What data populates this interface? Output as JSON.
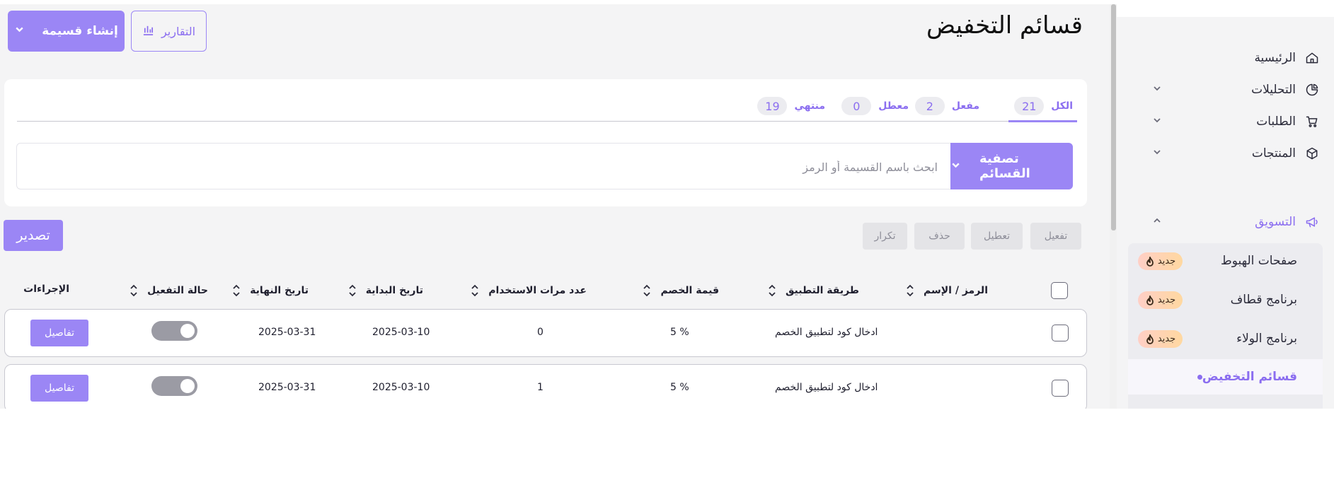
{
  "sidebar": {
    "items": [
      {
        "label": "الرئيسية",
        "icon": "home-icon"
      },
      {
        "label": "التحليلات",
        "icon": "pie-chart-icon"
      },
      {
        "label": "الطلبات",
        "icon": "cart-icon"
      },
      {
        "label": "المنتجات",
        "icon": "box-icon"
      },
      {
        "label": "التسويق",
        "icon": "megaphone-icon"
      }
    ],
    "submenu": [
      {
        "label": "صفحات الهبوط",
        "badge": "جديد"
      },
      {
        "label": "برنامج قطاف",
        "badge": "جديد"
      },
      {
        "label": "برنامج الولاء",
        "badge": "جديد"
      },
      {
        "label": "قسائم التخفيض"
      }
    ]
  },
  "header": {
    "title": "قسائم التخفيض",
    "create_label": "إنشاء قسيمة",
    "reports_label": "التقارير"
  },
  "tabs": [
    {
      "label": "الكل",
      "count": "21"
    },
    {
      "label": "مفعل",
      "count": "2"
    },
    {
      "label": "معطل",
      "count": "0"
    },
    {
      "label": "منتهي",
      "count": "19"
    }
  ],
  "search": {
    "filter_label": "تصفية القسائم",
    "placeholder": "ابحث باسم القسيمة أو الرمز"
  },
  "bulk_actions": {
    "activate": "تفعيل",
    "deactivate": "تعطيل",
    "delete": "حذف",
    "duplicate": "تكرار",
    "export": "تصدير"
  },
  "table": {
    "columns": {
      "code_name": "الرمز / الإسم",
      "apply_method": "طريقة التطبيق",
      "discount_value": "قيمة الخصم",
      "usage_count": "عدد مرات الاستخدام",
      "start_date": "تاريخ البداية",
      "end_date": "تاريخ النهاية",
      "status": "حالة التفعيل",
      "actions": "الإجراءات"
    },
    "rows": [
      {
        "apply_method": "ادخال كود لتطبيق الخصم",
        "discount_value": "5 %",
        "usage_count": "0",
        "start_date": "2025-03-10",
        "end_date": "2025-03-31",
        "details_label": "تفاصيل"
      },
      {
        "apply_method": "ادخال كود لتطبيق الخصم",
        "discount_value": "5 %",
        "usage_count": "1",
        "start_date": "2025-03-10",
        "end_date": "2025-03-31",
        "details_label": "تفاصيل"
      }
    ]
  },
  "colors": {
    "accent": "#9b86f5",
    "accent_text": "#8b6ef0",
    "background": "#f4f4f5"
  }
}
